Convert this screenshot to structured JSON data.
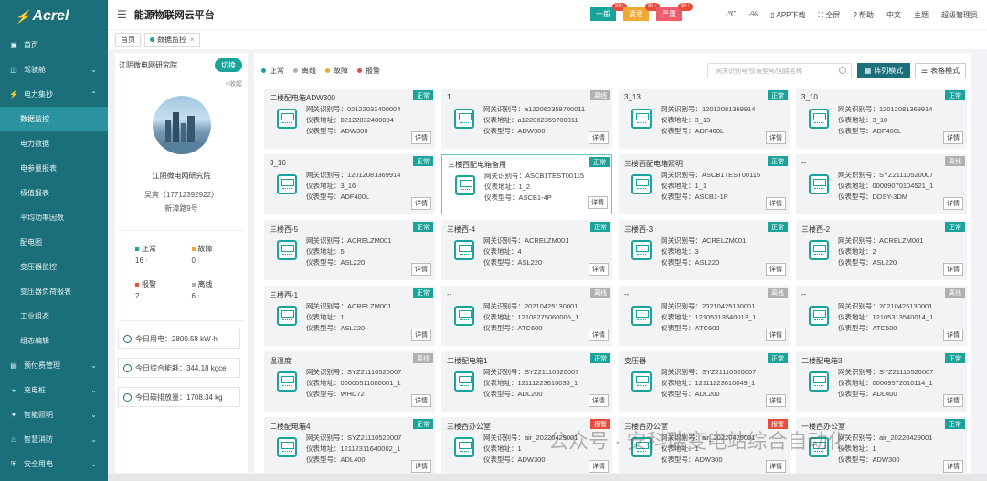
{
  "brand": {
    "logo": "Acrel",
    "app_title": "能源物联网云平台"
  },
  "colors": {
    "accent": "#1a6f7a",
    "normal": "#1aa39a",
    "offline": "#b0b0b0",
    "fault": "#f0a830",
    "alarm": "#e74c3c"
  },
  "header": {
    "alerts": [
      {
        "label": "一般",
        "count": "99+",
        "color": "#1aa39a"
      },
      {
        "label": "紧急",
        "count": "99+",
        "color": "#f0a830"
      },
      {
        "label": "严重",
        "count": "99+",
        "color": "#f05b6e"
      }
    ],
    "temp": "-℃",
    "humidity": "-%",
    "app_download": "APP下载",
    "fullscreen": "全屏",
    "help": "帮助",
    "language": "中文",
    "theme": "主题",
    "user": "超级管理员"
  },
  "tabs": [
    {
      "label": "首页"
    },
    {
      "label": "数据监控"
    }
  ],
  "sidebar": {
    "items": [
      {
        "label": "首页",
        "icon": "monitor-icon",
        "chev": ""
      },
      {
        "label": "驾驶舱",
        "icon": "dashboard-icon",
        "chev": "⌄"
      },
      {
        "label": "电力集抄",
        "icon": "power-icon",
        "chev": "⌃"
      },
      {
        "label": "数据监控",
        "sub": true,
        "active": true
      },
      {
        "label": "电力数据",
        "sub": true
      },
      {
        "label": "电参量报表",
        "sub": true
      },
      {
        "label": "极值报表",
        "sub": true
      },
      {
        "label": "平均功率因数",
        "sub": true
      },
      {
        "label": "配电图",
        "sub": true
      },
      {
        "label": "变压器监控",
        "sub": true
      },
      {
        "label": "变压器负荷报表",
        "sub": true
      },
      {
        "label": "工业组态",
        "sub": true
      },
      {
        "label": "组态编辑",
        "sub": true
      },
      {
        "label": "预付费管理",
        "icon": "card-icon",
        "chev": "⌄"
      },
      {
        "label": "充电桩",
        "icon": "charger-icon",
        "chev": "⌄"
      },
      {
        "label": "智能照明",
        "icon": "light-icon",
        "chev": "⌄"
      },
      {
        "label": "智慧消防",
        "icon": "fire-icon",
        "chev": "⌄"
      },
      {
        "label": "安全用电",
        "icon": "shield-icon",
        "chev": "⌄"
      }
    ]
  },
  "left": {
    "org": "江阴微电网研究院",
    "switch": "切换",
    "collapse": "<收起",
    "org_name": "江阴微电网研究院",
    "contact": "吴爽（17712392922）",
    "address": "新漳路9号",
    "stats": [
      {
        "label": "正常",
        "value": "16",
        "color": "#1aa39a"
      },
      {
        "label": "故障",
        "value": "0",
        "color": "#f0a830"
      },
      {
        "label": "报警",
        "value": "2",
        "color": "#e74c3c"
      },
      {
        "label": "离线",
        "value": "6",
        "color": "#b0b0b0"
      }
    ],
    "info": [
      "今日用电：2800.58 kW·h",
      "今日综合能耗：344.18 kgce",
      "今日碳排放量：1708.34 kg"
    ]
  },
  "main": {
    "legend": [
      {
        "label": "正常",
        "color": "#1aa39a"
      },
      {
        "label": "离线",
        "color": "#b0b0b0"
      },
      {
        "label": "故障",
        "color": "#f0a830"
      },
      {
        "label": "报警",
        "color": "#e74c3c"
      }
    ],
    "search_placeholder": "网关识别号/仪表型号/回路名称",
    "btn_grid": "阵列模式",
    "btn_table": "表格模式",
    "detail": "详情",
    "cards": [
      {
        "name": "二楼配电箱ADW300",
        "status": "正常",
        "gw": "网关识别号：02122032400004",
        "addr": "仪表地址：02122032400004",
        "model": "仪表型号：ADW300"
      },
      {
        "name": "1",
        "status": "离线",
        "gw": "网关识别号：a122062359700011",
        "addr": "仪表地址：a122062359700011",
        "model": "仪表型号：ADW300"
      },
      {
        "name": "3_13",
        "status": "正常",
        "gw": "网关识别号：12012081369914",
        "addr": "仪表地址：3_13",
        "model": "仪表型号：ADF400L"
      },
      {
        "name": "3_10",
        "status": "正常",
        "gw": "网关识别号：12012081369914",
        "addr": "仪表地址：3_10",
        "model": "仪表型号：ADF400L"
      },
      {
        "name": "3_16",
        "status": "正常",
        "gw": "网关识别号：12012081369914",
        "addr": "仪表地址：3_16",
        "model": "仪表型号：ADF400L"
      },
      {
        "name": "三楼西配电箱备用",
        "status": "正常",
        "gw": "网关识别号：ASCB1TEST00115",
        "addr": "仪表地址：1_2",
        "model": "仪表型号：ASCB1-4P",
        "selected": true
      },
      {
        "name": "三楼西配电箱照明",
        "status": "正常",
        "gw": "网关识别号：ASCB1TEST00115",
        "addr": "仪表地址：1_1",
        "model": "仪表型号：ASCB1-1P"
      },
      {
        "name": "--",
        "status": "离线",
        "gw": "网关识别号：SYZ21110520007",
        "addr": "仪表地址：00009070104521_1",
        "model": "仪表型号：DDSY-3DM"
      },
      {
        "name": "三楼西-5",
        "status": "正常",
        "gw": "网关识别号：ACRELZM001",
        "addr": "仪表地址：5",
        "model": "仪表型号：ASL220"
      },
      {
        "name": "三楼西-4",
        "status": "正常",
        "gw": "网关识别号：ACRELZM001",
        "addr": "仪表地址：4",
        "model": "仪表型号：ASL220"
      },
      {
        "name": "三楼西-3",
        "status": "正常",
        "gw": "网关识别号：ACRELZM001",
        "addr": "仪表地址：3",
        "model": "仪表型号：ASL220"
      },
      {
        "name": "三楼西-2",
        "status": "正常",
        "gw": "网关识别号：ACRELZM001",
        "addr": "仪表地址：2",
        "model": "仪表型号：ASL220"
      },
      {
        "name": "三楼西-1",
        "status": "正常",
        "gw": "网关识别号：ACRELZM001",
        "addr": "仪表地址：1",
        "model": "仪表型号：ASL220"
      },
      {
        "name": "--",
        "status": "离线",
        "gw": "网关识别号：20210425130001",
        "addr": "仪表地址：12108275060005_1",
        "model": "仪表型号：ATC600"
      },
      {
        "name": "--",
        "status": "离线",
        "gw": "网关识别号：20210425130001",
        "addr": "仪表地址：12105313540013_1",
        "model": "仪表型号：ATC600"
      },
      {
        "name": "--",
        "status": "离线",
        "gw": "网关识别号：20210425130001",
        "addr": "仪表地址：12105313540014_1",
        "model": "仪表型号：ATC600"
      },
      {
        "name": "温湿度",
        "status": "离线",
        "gw": "网关识别号：SYZ21110520007",
        "addr": "仪表地址：00000511080001_1",
        "model": "仪表型号：WHD72"
      },
      {
        "name": "二楼配电箱1",
        "status": "正常",
        "gw": "网关识别号：SYZ21110520007",
        "addr": "仪表地址：12111223610033_1",
        "model": "仪表型号：ADL200"
      },
      {
        "name": "变压器",
        "status": "正常",
        "gw": "网关识别号：SYZ21110520007",
        "addr": "仪表地址：12111223610049_1",
        "model": "仪表型号：ADL200"
      },
      {
        "name": "二楼配电箱3",
        "status": "正常",
        "gw": "网关识别号：SYZ21110520007",
        "addr": "仪表地址：00009572010114_1",
        "model": "仪表型号：ADL400"
      },
      {
        "name": "二楼配电箱4",
        "status": "正常",
        "gw": "网关识别号：SYZ21110520007",
        "addr": "仪表地址：12112311640002_1",
        "model": "仪表型号：ADL400"
      },
      {
        "name": "三楼西办公室",
        "status": "报警",
        "gw": "网关识别号：air_20220429001",
        "addr": "仪表地址：1",
        "model": "仪表型号：ADW300"
      },
      {
        "name": "三楼西办公室",
        "status": "报警",
        "gw": "网关识别号：air_20220429001",
        "addr": "仪表地址：1",
        "model": "仪表型号：ADW300"
      },
      {
        "name": "一楼西办公室",
        "status": "正常",
        "gw": "网关识别号：air_20220429001",
        "addr": "仪表地址：1",
        "model": "仪表型号：ADW300"
      }
    ]
  },
  "watermark": "公众号 · 安科瑞变电站综合自动化"
}
